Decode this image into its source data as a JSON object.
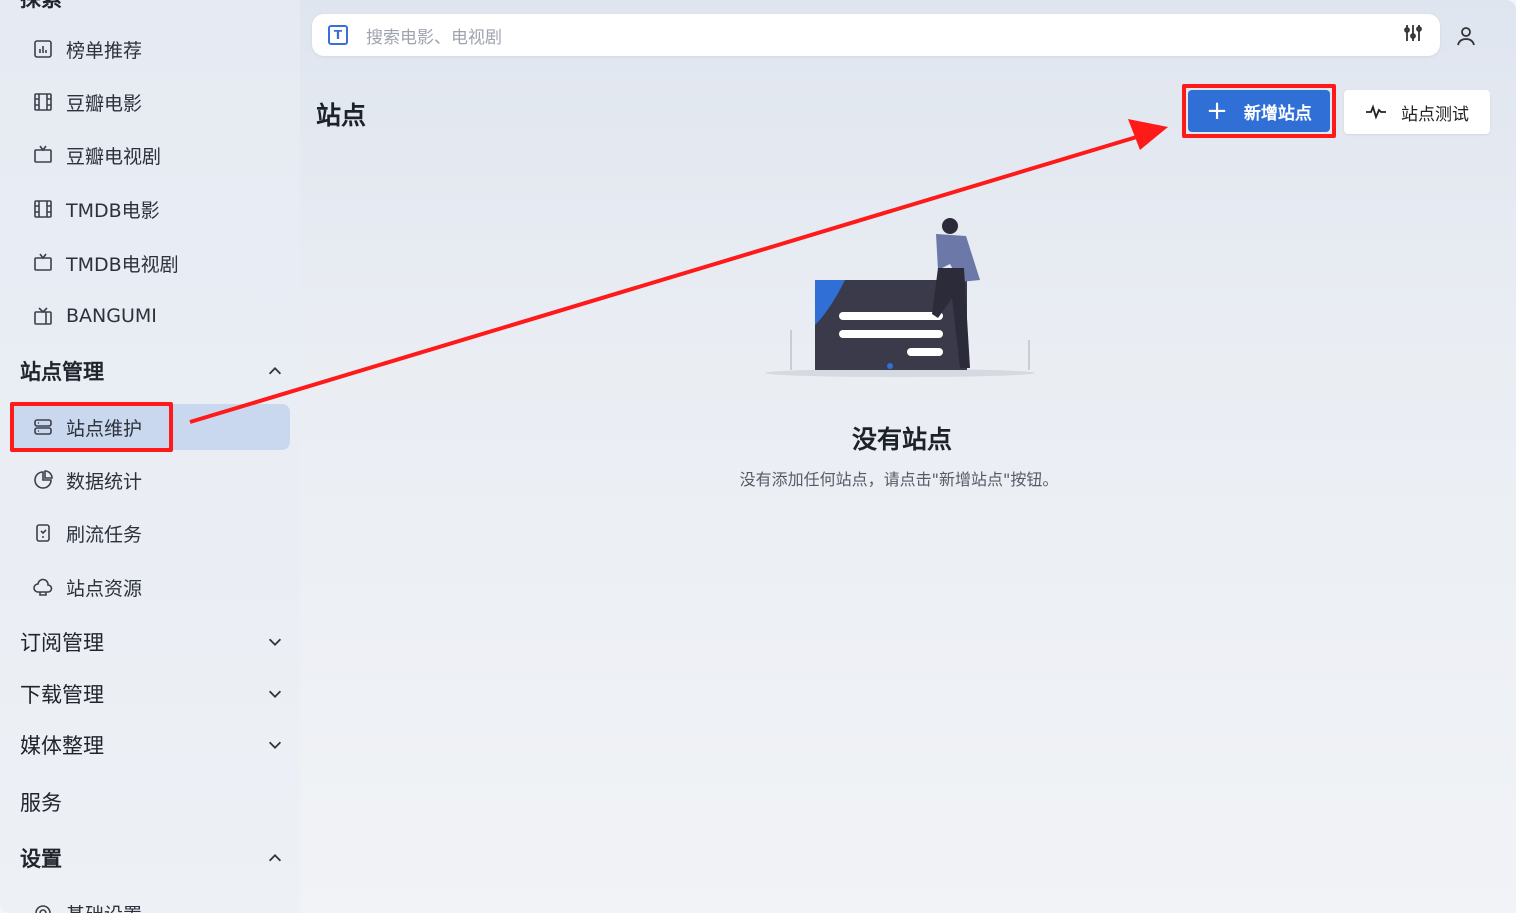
{
  "sidebar": {
    "top_partial_label": "探索",
    "items": [
      {
        "label": "榜单推荐",
        "icon": "chart-icon"
      },
      {
        "label": "豆瓣电影",
        "icon": "film-icon"
      },
      {
        "label": "豆瓣电视剧",
        "icon": "tv-icon"
      },
      {
        "label": "TMDB电影",
        "icon": "film-icon"
      },
      {
        "label": "TMDB电视剧",
        "icon": "tv-icon"
      },
      {
        "label": "BANGUMI",
        "icon": "tv-retro-icon"
      }
    ],
    "groups": {
      "site_mgmt": {
        "label": "站点管理",
        "expanded": true
      },
      "subscribe_mgmt": {
        "label": "订阅管理",
        "expanded": false
      },
      "download_mgmt": {
        "label": "下载管理",
        "expanded": false
      },
      "media_mgmt": {
        "label": "媒体整理",
        "expanded": false
      },
      "services": {
        "label": "服务"
      },
      "settings": {
        "label": "设置",
        "expanded": true
      }
    },
    "site_items": [
      {
        "label": "站点维护",
        "icon": "server-icon",
        "active": true
      },
      {
        "label": "数据统计",
        "icon": "pie-chart-icon"
      },
      {
        "label": "刷流任务",
        "icon": "task-icon"
      },
      {
        "label": "站点资源",
        "icon": "cloud-icon"
      }
    ],
    "bottom_partial_label": "基础设置"
  },
  "search": {
    "placeholder": "搜索电影、电视剧"
  },
  "page": {
    "title": "站点",
    "add_button": "新增站点",
    "test_button": "站点测试"
  },
  "empty_state": {
    "title": "没有站点",
    "description": "没有添加任何站点，请点击\"新增站点\"按钮。"
  },
  "colors": {
    "primary": "#2f6fd6",
    "active_nav": "#c9d8ee",
    "annotation": "#ff1a1a"
  }
}
